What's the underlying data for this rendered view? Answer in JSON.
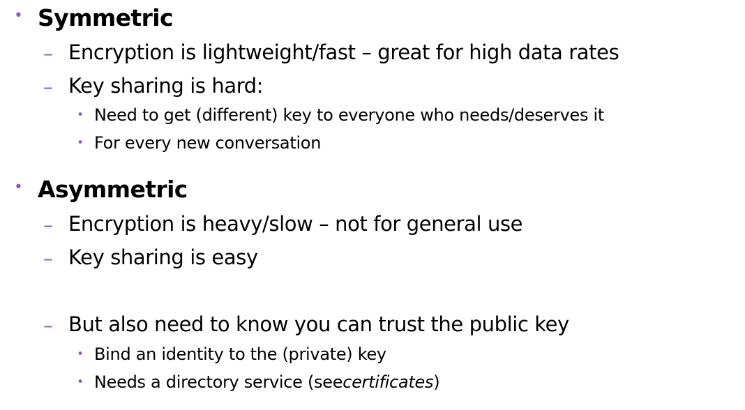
{
  "colors": {
    "bullet": "#8f58c4",
    "text": "#000000",
    "background": "#ffffff"
  },
  "sections": [
    {
      "heading": "Symmetric",
      "points": [
        {
          "text": "Encryption is lightweight/fast – great for high data rates"
        },
        {
          "text": "Key sharing is hard:",
          "subpoints": [
            "Need to get (different) key to everyone who needs/deserves it",
            "For every new conversation"
          ]
        }
      ]
    },
    {
      "heading": "Asymmetric",
      "points": [
        {
          "text": "Encryption is heavy/slow – not for general use"
        },
        {
          "text": "Key sharing is easy"
        },
        {
          "text": "But also need to know you can trust the public key",
          "subpoints": [
            "Bind an identity to the (private) key"
          ],
          "last_subpoint": {
            "before": "Needs a directory service (see ",
            "italic": "certificates",
            "after": ")"
          }
        }
      ]
    }
  ],
  "bullet_chars": {
    "level1": "•",
    "level2": "–",
    "level3": "•"
  }
}
